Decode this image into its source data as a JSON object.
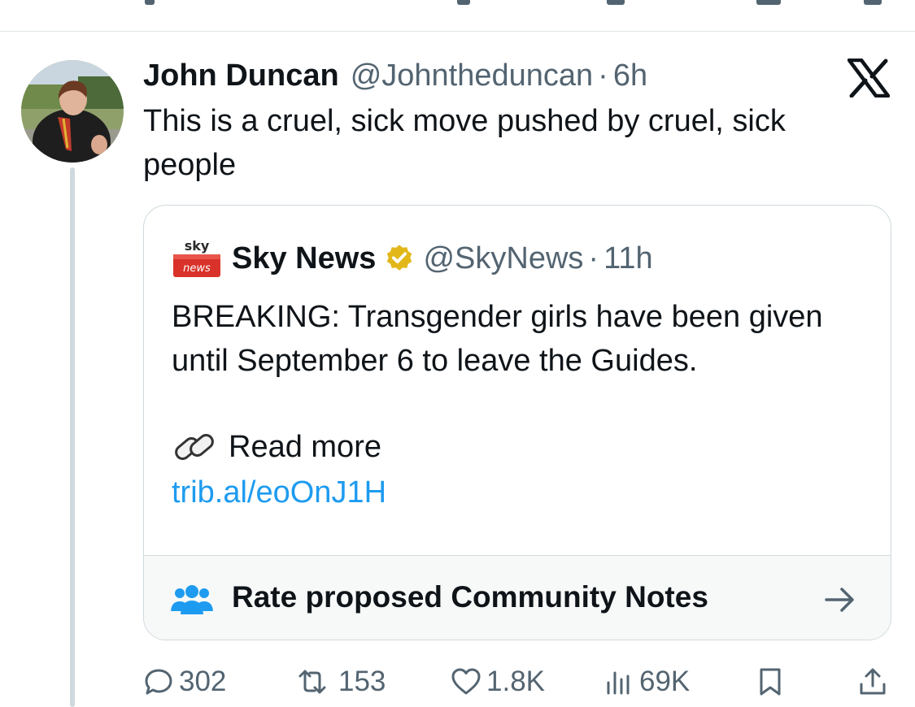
{
  "post": {
    "author_name": "John Duncan",
    "author_handle": "@Johntheduncan",
    "separator": "·",
    "time": "6h",
    "text": "This is a cruel, sick move pushed by cruel, sick people"
  },
  "quote": {
    "author_name": "Sky News",
    "author_handle": "@SkyNews",
    "separator": "·",
    "time": "11h",
    "text": "BREAKING: Transgender girls have been given until September 6 to leave the Guides.",
    "read_more": "Read more",
    "link": "trib.al/eoOnJ1H",
    "logo_top": "sky",
    "logo_bottom": "news"
  },
  "community_notes": {
    "label": "Rate proposed Community Notes"
  },
  "actions": {
    "replies": "302",
    "reposts": "153",
    "likes": "1.8K",
    "views": "69K"
  },
  "colors": {
    "link": "#1d9bf0",
    "muted": "#536471",
    "verified_gold": "#e2b719",
    "sky_red": "#d9322a"
  },
  "icons": [
    "x-logo-icon",
    "verified-badge-icon",
    "link-icon",
    "community-notes-icon",
    "arrow-right-icon",
    "reply-icon",
    "repost-icon",
    "like-icon",
    "views-icon",
    "bookmark-icon",
    "share-icon"
  ]
}
